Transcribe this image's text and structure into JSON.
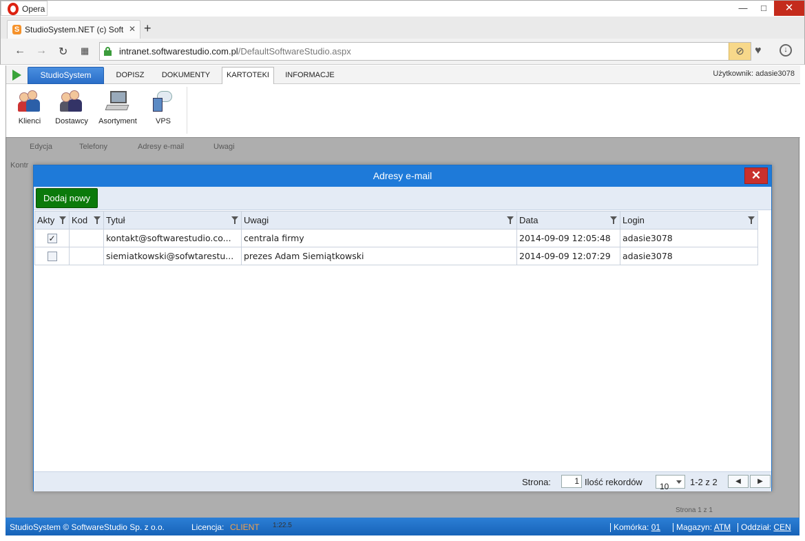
{
  "browser": {
    "app_name": "Opera",
    "tab_title": "StudioSystem.NET (c) Soft",
    "url_domain": "intranet.softwarestudio.com.pl",
    "url_path": "/DefaultSoftwareStudio.aspx"
  },
  "menu": {
    "studio_label": "StudioSystem",
    "tabs": [
      "DOPISZ",
      "DOKUMENTY",
      "KARTOTEKI",
      "INFORMACJE"
    ],
    "active_tab": "KARTOTEKI",
    "user_label": "Użytkownik: adasie3078"
  },
  "ribbon": {
    "items": [
      "Klienci",
      "Dostawcy",
      "Asortyment",
      "VPS"
    ]
  },
  "behind": {
    "toolbar": [
      "Edycja",
      "Telefony",
      "Adresy e-mail",
      "Uwagi"
    ],
    "section_label": "Kontr",
    "pager": "Strona 1 z 1"
  },
  "dialog": {
    "title": "Adresy e-mail",
    "close_label": "✕",
    "add_label": "Dodaj nowy",
    "columns": [
      "Akty",
      "Kod",
      "Tytuł",
      "Uwagi",
      "Data",
      "Login"
    ],
    "rows": [
      {
        "active": true,
        "kod": "",
        "tytul": "kontakt@softwarestudio.co...",
        "uwagi": "centrala firmy",
        "data": "2014-09-09 12:05:48",
        "login": "adasie3078"
      },
      {
        "active": false,
        "kod": "",
        "tytul": "siemiatkowski@sofwtarestu...",
        "uwagi": "prezes Adam Siemiątkowski",
        "data": "2014-09-09 12:07:29",
        "login": "adasie3078"
      }
    ],
    "footer": {
      "page_label": "Strona:",
      "page_value": "1",
      "records_label": "Ilość rekordów",
      "records_value": "10",
      "range": "1-2 z 2"
    }
  },
  "status": {
    "copyright": "StudioSystem © SoftwareStudio Sp. z o.o.",
    "license_label": "Licencja:",
    "license_value": "CLIENT",
    "time": "1:22.5",
    "cell_label": "Komórka:",
    "cell_value": "01",
    "store_label": "Magazyn:",
    "store_value": "ATM",
    "branch_label": "Oddział:",
    "branch_value": "CEN"
  }
}
